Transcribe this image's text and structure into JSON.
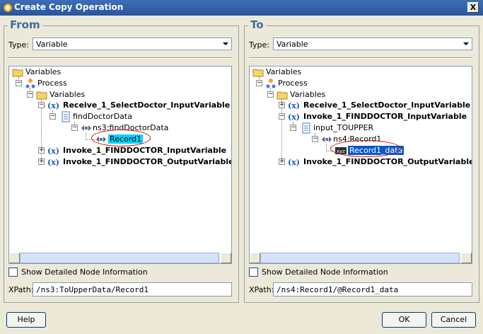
{
  "window": {
    "title": "Create Copy Operation",
    "close_label": "X"
  },
  "from": {
    "title": "From",
    "type_label": "Type:",
    "type_value": "Variable",
    "checkbox_label": "Show Detailed Node Information",
    "xpath_label": "XPath:",
    "xpath_value": "/ns3:ToUpperData/Record1",
    "tree": {
      "root": "Variables",
      "process": "Process",
      "variables": "Variables",
      "var1": "Receive_1_SelectDoctor_InputVariable",
      "var1_part": "findDoctorData",
      "var1_elem": "ns3:findDoctorData",
      "var1_selected": "Record1",
      "var2": "Invoke_1_FINDDOCTOR_InputVariable",
      "var3": "Invoke_1_FINDDOCTOR_OutputVariable"
    }
  },
  "to": {
    "title": "To",
    "type_label": "Type:",
    "type_value": "Variable",
    "checkbox_label": "Show Detailed Node Information",
    "xpath_label": "XPath:",
    "xpath_value": "/ns4:Record1/@Record1_data",
    "tree": {
      "root": "Variables",
      "process": "Process",
      "variables": "Variables",
      "var1": "Receive_1_SelectDoctor_InputVariable",
      "var2": "Invoke_1_FINDDOCTOR_InputVariable",
      "var2_part": "input_TOUPPER",
      "var2_elem": "ns4:Record1",
      "var2_selected": "Record1_data",
      "var3": "Invoke_1_FINDDOCTOR_OutputVariable"
    }
  },
  "buttons": {
    "help": "Help",
    "ok": "OK",
    "cancel": "Cancel"
  },
  "colors": {
    "accent": "#3a6ea5",
    "selection": "#0a58cf",
    "selection_cyan": "#00d4ff",
    "highlight_oval": "#d01010"
  }
}
